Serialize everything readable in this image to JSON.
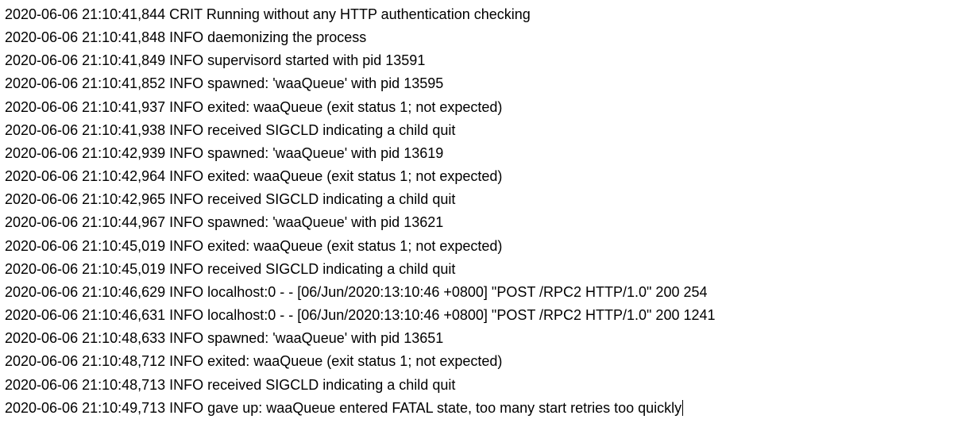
{
  "log": {
    "lines": [
      "2020-06-06 21:10:41,844 CRIT Running without any HTTP authentication checking",
      "2020-06-06 21:10:41,848 INFO daemonizing the process",
      "2020-06-06 21:10:41,849 INFO supervisord started with pid 13591",
      "2020-06-06 21:10:41,852 INFO spawned: 'waaQueue' with pid 13595",
      "2020-06-06 21:10:41,937 INFO exited: waaQueue (exit status 1; not expected)",
      "2020-06-06 21:10:41,938 INFO received SIGCLD indicating a child quit",
      "2020-06-06 21:10:42,939 INFO spawned: 'waaQueue' with pid 13619",
      "2020-06-06 21:10:42,964 INFO exited: waaQueue (exit status 1; not expected)",
      "2020-06-06 21:10:42,965 INFO received SIGCLD indicating a child quit",
      "2020-06-06 21:10:44,967 INFO spawned: 'waaQueue' with pid 13621",
      "2020-06-06 21:10:45,019 INFO exited: waaQueue (exit status 1; not expected)",
      "2020-06-06 21:10:45,019 INFO received SIGCLD indicating a child quit",
      "2020-06-06 21:10:46,629 INFO localhost:0 - - [06/Jun/2020:13:10:46 +0800] \"POST /RPC2 HTTP/1.0\" 200 254",
      "2020-06-06 21:10:46,631 INFO localhost:0 - - [06/Jun/2020:13:10:46 +0800] \"POST /RPC2 HTTP/1.0\" 200 1241",
      "2020-06-06 21:10:48,633 INFO spawned: 'waaQueue' with pid 13651",
      "2020-06-06 21:10:48,712 INFO exited: waaQueue (exit status 1; not expected)",
      "2020-06-06 21:10:48,713 INFO received SIGCLD indicating a child quit",
      "2020-06-06 21:10:49,713 INFO gave up: waaQueue entered FATAL state, too many start retries too quickly"
    ],
    "cursor_line_index": 17
  }
}
